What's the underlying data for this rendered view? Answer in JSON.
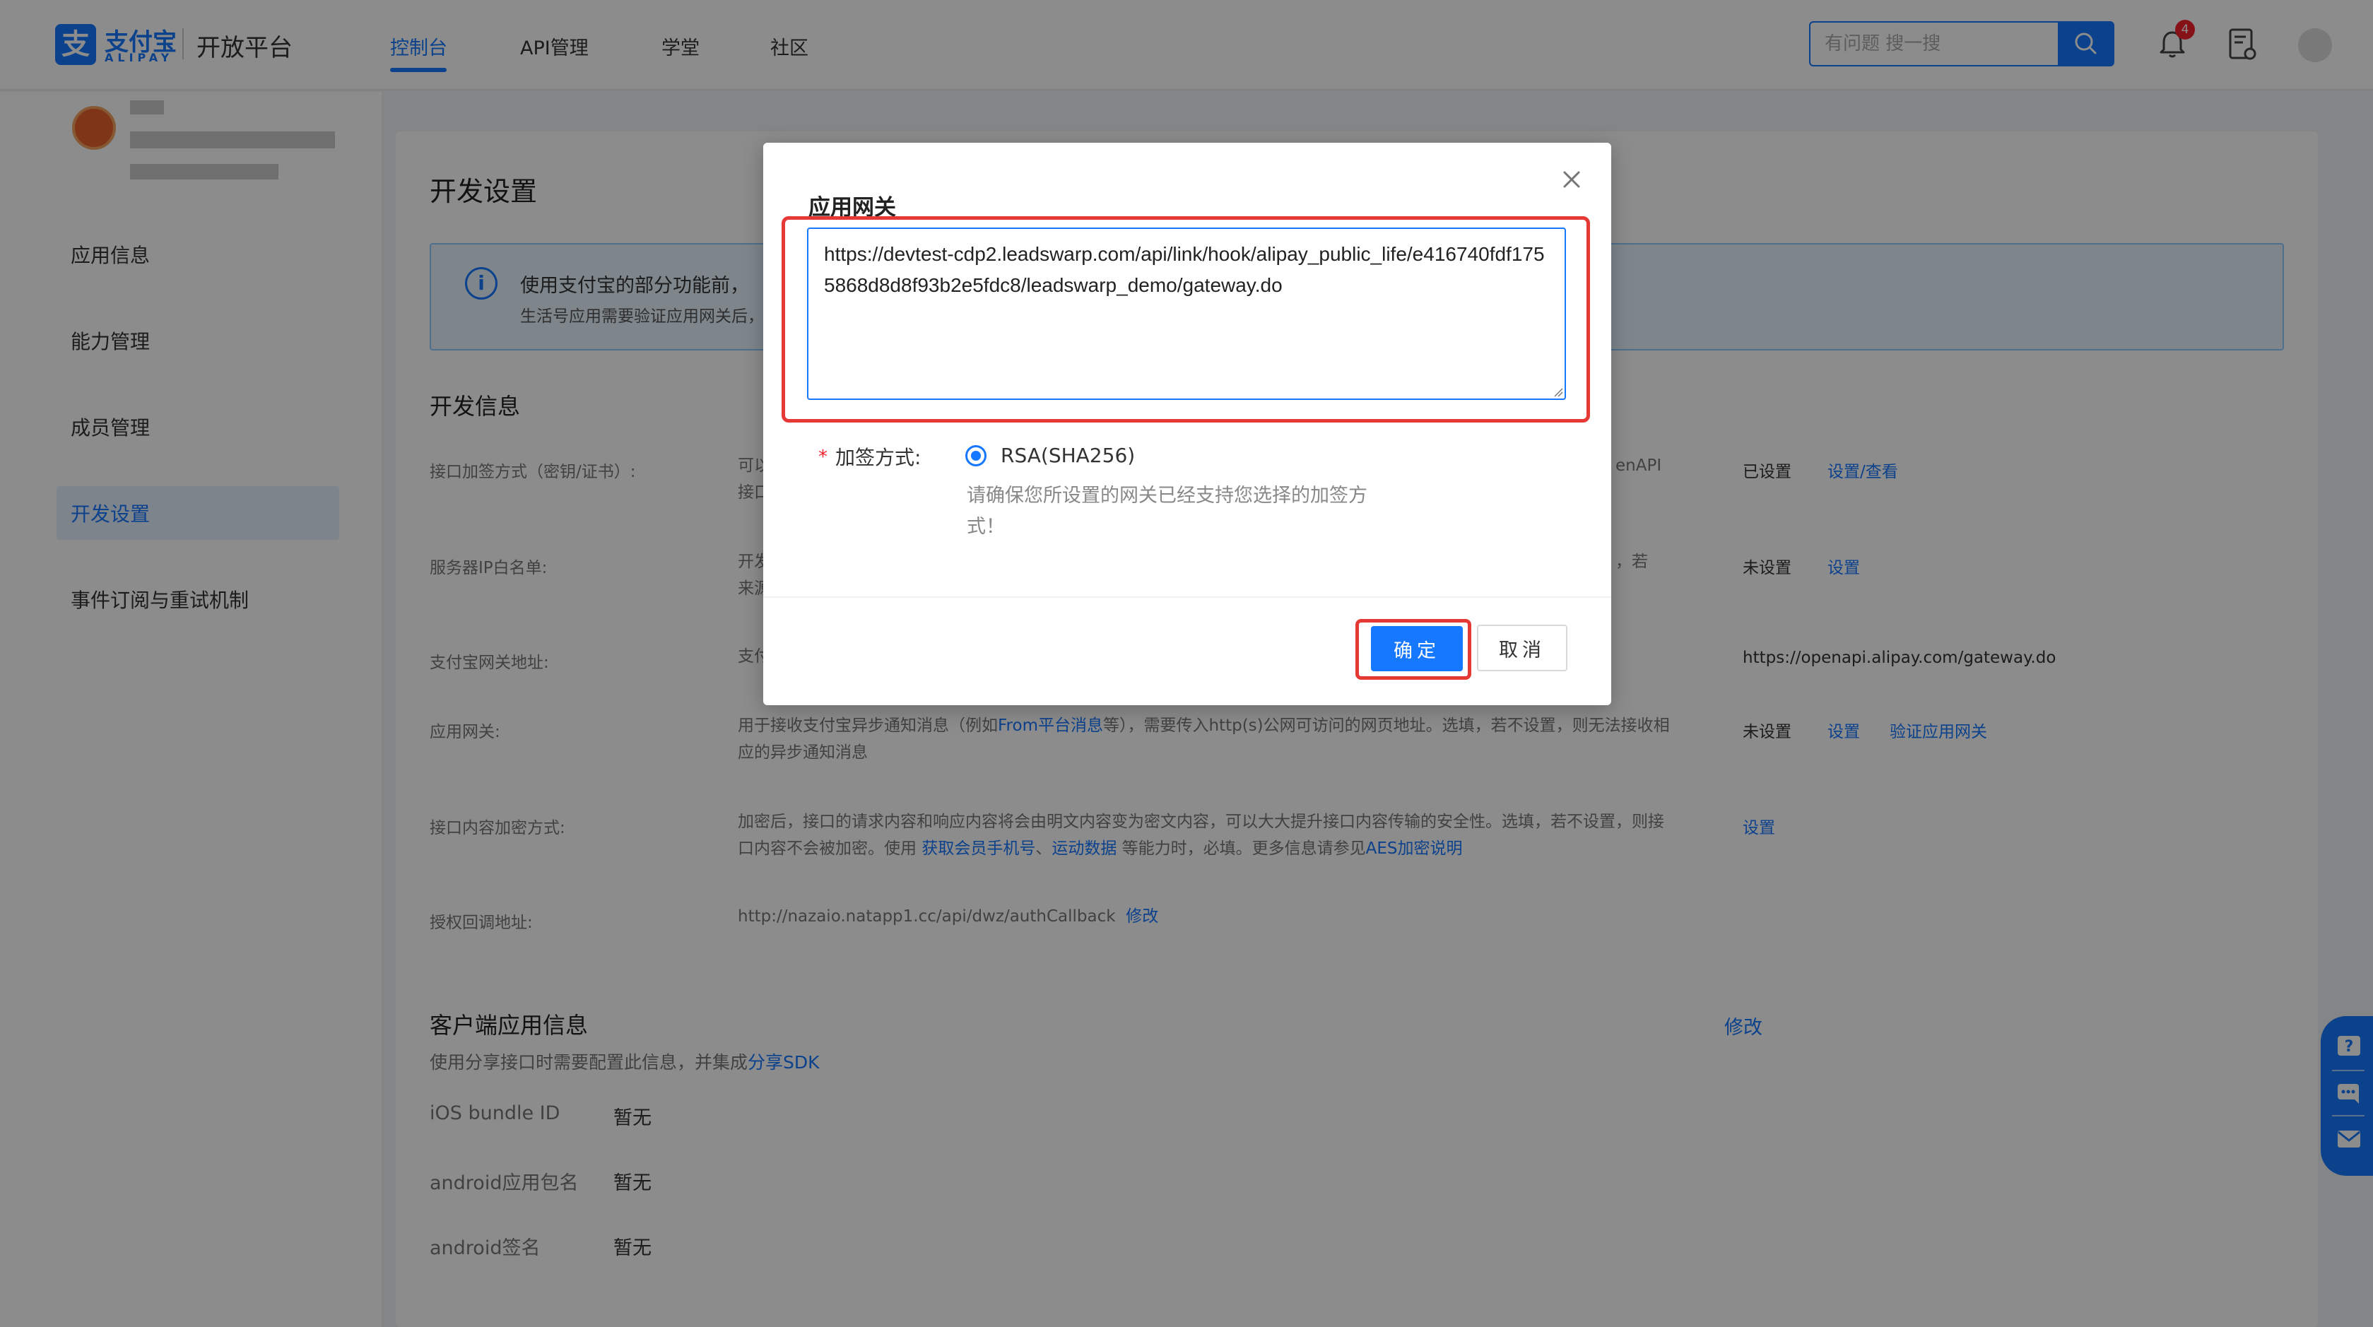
{
  "header": {
    "logo_mark": "支",
    "logo_cn": "支付宝",
    "logo_en": "ALIPAY",
    "platform": "开放平台",
    "nav": [
      {
        "label": "控制台",
        "active": true
      },
      {
        "label": "API管理",
        "active": false
      },
      {
        "label": "学堂",
        "active": false
      },
      {
        "label": "社区",
        "active": false
      }
    ],
    "search_placeholder": "有问题 搜一搜",
    "notification_count": "4"
  },
  "sidebar": {
    "items": [
      {
        "label": "应用信息",
        "active": false
      },
      {
        "label": "能力管理",
        "active": false
      },
      {
        "label": "成员管理",
        "active": false
      },
      {
        "label": "开发设置",
        "active": true
      },
      {
        "label": "事件订阅与重试机制",
        "active": false
      }
    ]
  },
  "main": {
    "page_title": "开发设置",
    "banner": {
      "line1": "使用支付宝的部分功能前，",
      "line2": "生活号应用需要验证应用网关后，"
    },
    "dev_info_title": "开发信息",
    "rows": [
      {
        "label": "接口加签方式（密钥/证书）:",
        "desc": "可以 接口",
        "desc_tail": "enAPI",
        "status": "已设置",
        "links": [
          "设置/查看"
        ]
      },
      {
        "label": "服务器IP白名单:",
        "desc": "开发 来源",
        "desc_tail": "，若",
        "status": "未设置",
        "links": [
          "设置"
        ]
      },
      {
        "label": "支付宝网关地址:",
        "desc": "支付",
        "desc_tail": "",
        "status": "https://openapi.alipay.com/gateway.do",
        "links": []
      },
      {
        "label": "应用网关:",
        "desc_pre": "用于接收支付宝异步通知消息（例如",
        "desc_link": "From平台消息",
        "desc_post": "等），需要传入http(s)公网可访问的网页地址。选填，若不设置，则无法接收相应的异步通知消息",
        "status": "未设置",
        "links": [
          "设置",
          "验证应用网关"
        ]
      },
      {
        "label": "接口内容加密方式:",
        "desc_pre": "加密后，接口的请求内容和响应内容将会由明文内容变为密文内容，可以大大提升接口内容传输的安全性。选填，若不设置，则接口内容不会被加密。使用 ",
        "desc_link1": "获取会员手机号",
        "desc_sep": "、",
        "desc_link2": "运动数据",
        "desc_mid": " 等能力时，必填。更多信息请参见",
        "desc_link3": "AES加密说明",
        "status": "",
        "links": [
          "设置"
        ]
      },
      {
        "label": "授权回调地址:",
        "value": "http://nazaio.natapp1.cc/api/dwz/authCallback",
        "link": "修改"
      }
    ],
    "client_info": {
      "title": "客户端应用信息",
      "edit": "修改",
      "desc_pre": "使用分享接口时需要配置此信息，并集成",
      "desc_link": "分享SDK",
      "items": [
        {
          "label": "iOS bundle ID",
          "value": "暂无"
        },
        {
          "label": "android应用包名",
          "value": "暂无"
        },
        {
          "label": "android签名",
          "value": "暂无"
        }
      ]
    }
  },
  "modal": {
    "field_label": "应用网关",
    "gateway_value": "https://devtest-cdp2.leadswarp.com/api/link/hook/alipay_public_life/e416740fdf1755868d8d8f93b2e5fdc8/leadswarp_demo/gateway.do",
    "required_mark": "*",
    "sign_label": "加签方式:",
    "sign_option": "RSA(SHA256)",
    "hint": "请确保您所设置的网关已经支持您选择的加签方式！",
    "ok_label": "确定",
    "cancel_label": "取消"
  },
  "colors": {
    "accent": "#1677ff",
    "highlight_frame": "#e53935",
    "mask": "rgba(0,0,0,0.45)"
  }
}
